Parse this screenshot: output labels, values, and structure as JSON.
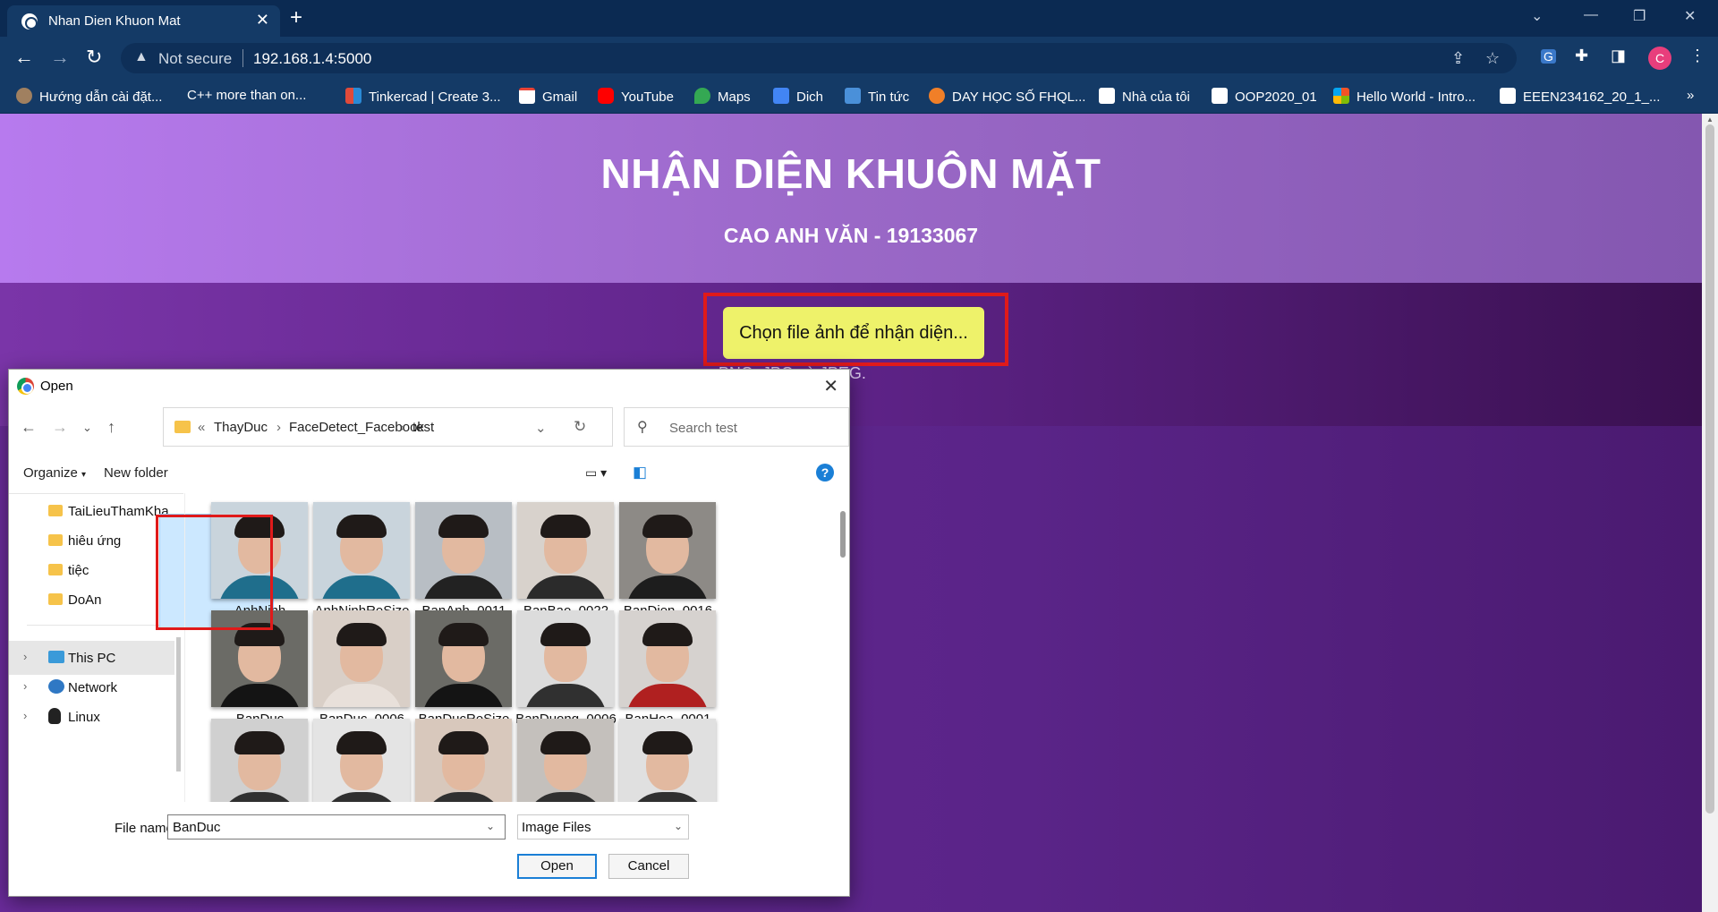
{
  "browser": {
    "tab_title": "Nhan Dien Khuon Mat",
    "not_secure": "Not secure",
    "url": "192.168.1.4:5000",
    "profile_initial": "C",
    "bookmarks": [
      "Hướng dẫn cài đặt...",
      "C++ more than on...",
      "Tinkercad | Create 3...",
      "Gmail",
      "YouTube",
      "Maps",
      "Dich",
      "Tin tức",
      "DAY HỌC SỐ FHQL...",
      "Nhà của tôi",
      "OOP2020_01",
      "Hello World - Intro...",
      "EEEN234162_20_1_..."
    ],
    "bookmarks_overflow": "»"
  },
  "page": {
    "title": "NHẬN DIỆN KHUÔN MẶT",
    "subtitle": "CAO ANH VĂN - 19133067",
    "choose_button": "Chọn file ảnh để nhận diện...",
    "hint_visible": "ược: PNG, JPG và JPEG."
  },
  "dialog": {
    "title": "Open",
    "breadcrumb": [
      "ThayDuc",
      "FaceDetect_Facebook",
      "test"
    ],
    "breadcrumb_prefix": "«",
    "search_placeholder": "Search test",
    "organize": "Organize",
    "new_folder": "New folder",
    "help": "?",
    "nav_items": [
      {
        "label": "TaiLieuThamKha",
        "kind": "folder"
      },
      {
        "label": "hiêu ứng",
        "kind": "folder"
      },
      {
        "label": "tiệc",
        "kind": "folder"
      },
      {
        "label": "DoAn",
        "kind": "folder"
      },
      {
        "label": "This PC",
        "kind": "pc"
      },
      {
        "label": "Network",
        "kind": "network"
      },
      {
        "label": "Linux",
        "kind": "linux"
      }
    ],
    "files": [
      {
        "name": "AnhNinh",
        "bg": "#c9d4dc",
        "shirt": "#1f6e8c"
      },
      {
        "name": "AnhNinhReSize",
        "bg": "#c9d4dc",
        "shirt": "#1f6e8c"
      },
      {
        "name": "BanAnh_0011",
        "bg": "#b8bec4",
        "shirt": "#222222"
      },
      {
        "name": "BanBao_0022",
        "bg": "#d8d2cc",
        "shirt": "#2b2b2b"
      },
      {
        "name": "BanDien_0016",
        "bg": "#8d8a86",
        "shirt": "#1d1d1d"
      },
      {
        "name": "BanDuc",
        "bg": "#6b6b66",
        "shirt": "#141414"
      },
      {
        "name": "BanDuc_0006",
        "bg": "#d9cfc7",
        "shirt": "#e8e0da"
      },
      {
        "name": "BanDucReSize",
        "bg": "#6b6b66",
        "shirt": "#141414"
      },
      {
        "name": "BanDuong_0006",
        "bg": "#dcdcdc",
        "shirt": "#303030"
      },
      {
        "name": "BanHoa_0001",
        "bg": "#d6d2cf",
        "shirt": "#b02020"
      },
      {
        "name": "",
        "bg": "#d0d0d0",
        "shirt": "#303030"
      },
      {
        "name": "",
        "bg": "#e4e4e4",
        "shirt": "#303030"
      },
      {
        "name": "",
        "bg": "#d8c8bc",
        "shirt": "#303030"
      },
      {
        "name": "",
        "bg": "#c4c0bc",
        "shirt": "#303030"
      },
      {
        "name": "",
        "bg": "#e0e0e0",
        "shirt": "#303030"
      }
    ],
    "file_name_label": "File name:",
    "file_name_value": "BanDuc",
    "file_type": "Image Files",
    "open_button": "Open",
    "cancel_button": "Cancel"
  }
}
